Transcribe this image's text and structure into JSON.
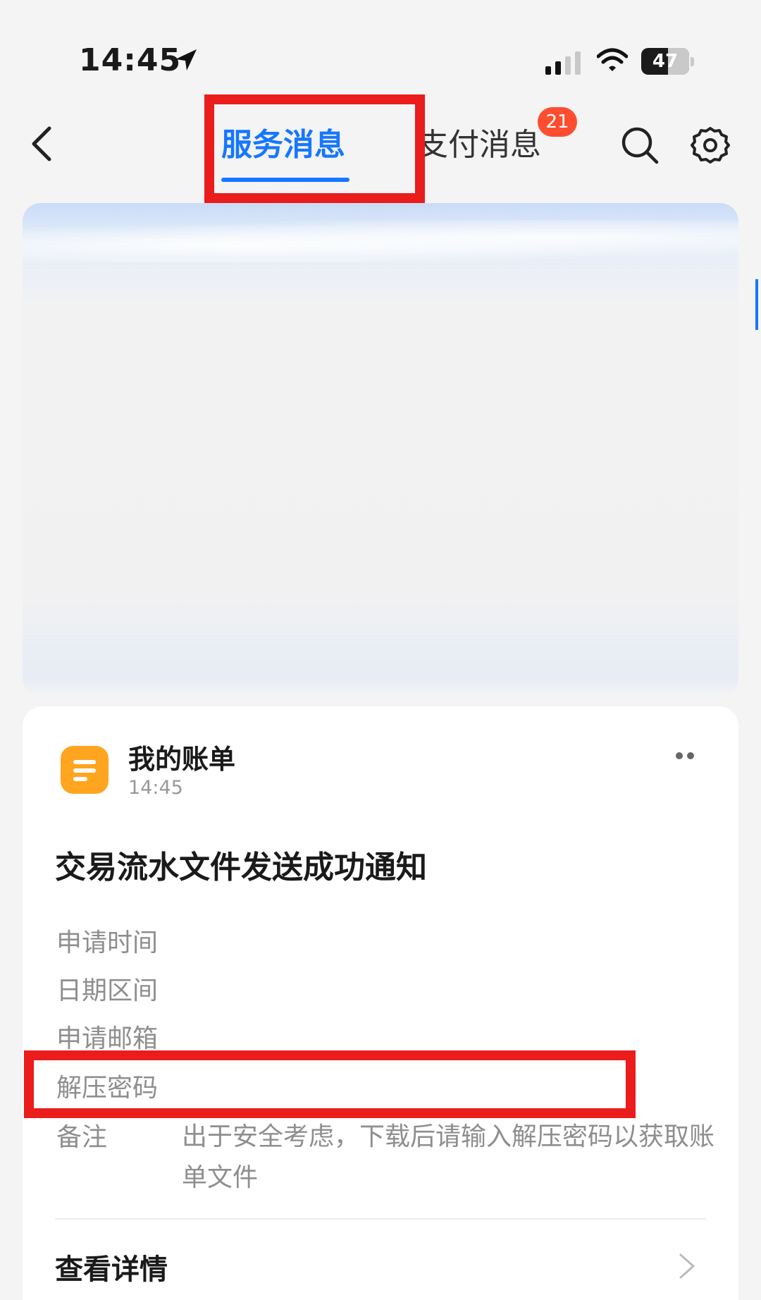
{
  "status_bar": {
    "time": "14:45",
    "battery": "47"
  },
  "nav": {
    "tabs": [
      {
        "label": "服务消息",
        "active": true
      },
      {
        "label": "支付消息",
        "active": false,
        "badge": "21"
      }
    ]
  },
  "card": {
    "app_name": "我的账单",
    "time": "14:45",
    "title": "交易流水文件发送成功通知",
    "fields": [
      {
        "label": "申请时间",
        "value": ""
      },
      {
        "label": "日期区间",
        "value": ""
      },
      {
        "label": "申请邮箱",
        "value": ""
      },
      {
        "label": "解压密码",
        "value": ""
      },
      {
        "label": "备注",
        "value": "出于安全考虑，下载后请输入解压密码以获取账单文件"
      }
    ],
    "details_label": "查看详情"
  },
  "colors": {
    "accent": "#1677ff",
    "badge": "#ff4d30",
    "highlight": "#ea1c1c",
    "app_icon": "#ffa51f"
  }
}
